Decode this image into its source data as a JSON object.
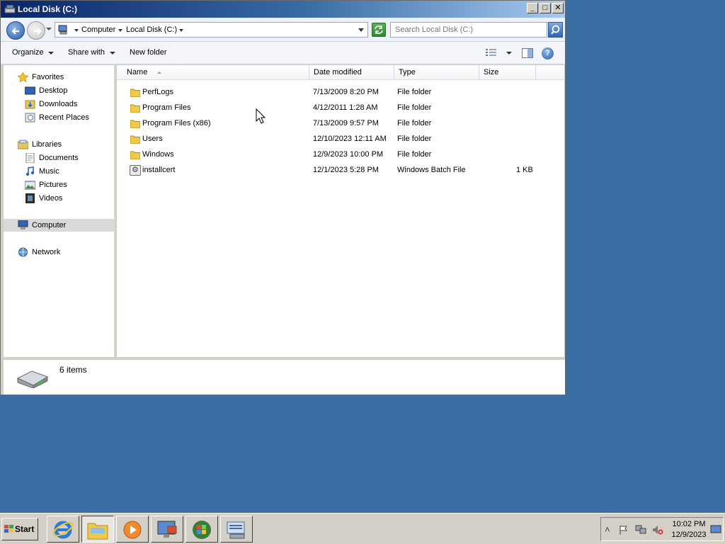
{
  "window": {
    "title": "Local Disk (C:)",
    "controls": {
      "minimize": "_",
      "maximize": "□",
      "close": "✕"
    }
  },
  "address": {
    "breadcrumbs": [
      "Computer",
      "Local Disk (C:)"
    ],
    "search_placeholder": "Search Local Disk (C:)"
  },
  "commands": {
    "organize": "Organize",
    "share_with": "Share with",
    "new_folder": "New folder",
    "help": "?"
  },
  "nav": {
    "favorites": {
      "label": "Favorites",
      "items": [
        "Desktop",
        "Downloads",
        "Recent Places"
      ]
    },
    "libraries": {
      "label": "Libraries",
      "items": [
        "Documents",
        "Music",
        "Pictures",
        "Videos"
      ]
    },
    "computer": "Computer",
    "network": "Network"
  },
  "columns": [
    "Name",
    "Date modified",
    "Type",
    "Size"
  ],
  "files": [
    {
      "name": "PerfLogs",
      "date": "7/13/2009 8:20 PM",
      "type": "File folder",
      "size": "",
      "icon": "folder-icon"
    },
    {
      "name": "Program Files",
      "date": "4/12/2011 1:28 AM",
      "type": "File folder",
      "size": "",
      "icon": "folder-icon"
    },
    {
      "name": "Program Files (x86)",
      "date": "7/13/2009 9:57 PM",
      "type": "File folder",
      "size": "",
      "icon": "folder-icon"
    },
    {
      "name": "Users",
      "date": "12/10/2023 12:11 AM",
      "type": "File folder",
      "size": "",
      "icon": "folder-icon"
    },
    {
      "name": "Windows",
      "date": "12/9/2023 10:00 PM",
      "type": "File folder",
      "size": "",
      "icon": "folder-icon"
    },
    {
      "name": "installcert",
      "date": "12/1/2023 5:28 PM",
      "type": "Windows Batch File",
      "size": "1 KB",
      "icon": "batch-file-icon"
    }
  ],
  "details": {
    "count": "6 items"
  },
  "taskbar": {
    "start": "Start",
    "clock_time": "10:02 PM",
    "clock_date": "12/9/2023"
  }
}
